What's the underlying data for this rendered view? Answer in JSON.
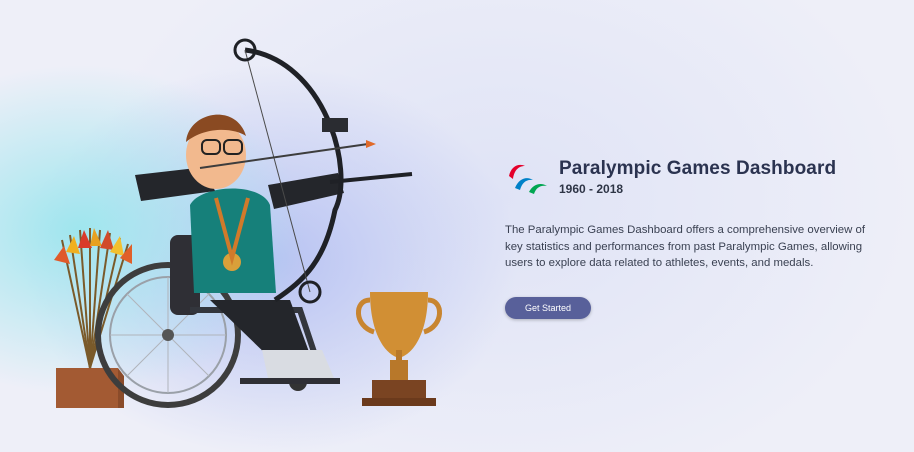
{
  "hero": {
    "title": "Paralympic Games Dashboard",
    "years": "1960 - 2018",
    "description": "The Paralympic Games Dashboard offers a comprehensive overview of key statistics and performances from past Paralympic Games, allowing users to explore data related to athletes, events, and medals.",
    "cta_label": "Get Started"
  },
  "logo": {
    "icon": "paralympic-agitos-icon",
    "colors": [
      "#e4002b",
      "#0081c8",
      "#00a651"
    ]
  },
  "illustration": {
    "icon": "wheelchair-archer-illustration"
  },
  "colors": {
    "title": "#2b3350",
    "button": "#58609a"
  }
}
